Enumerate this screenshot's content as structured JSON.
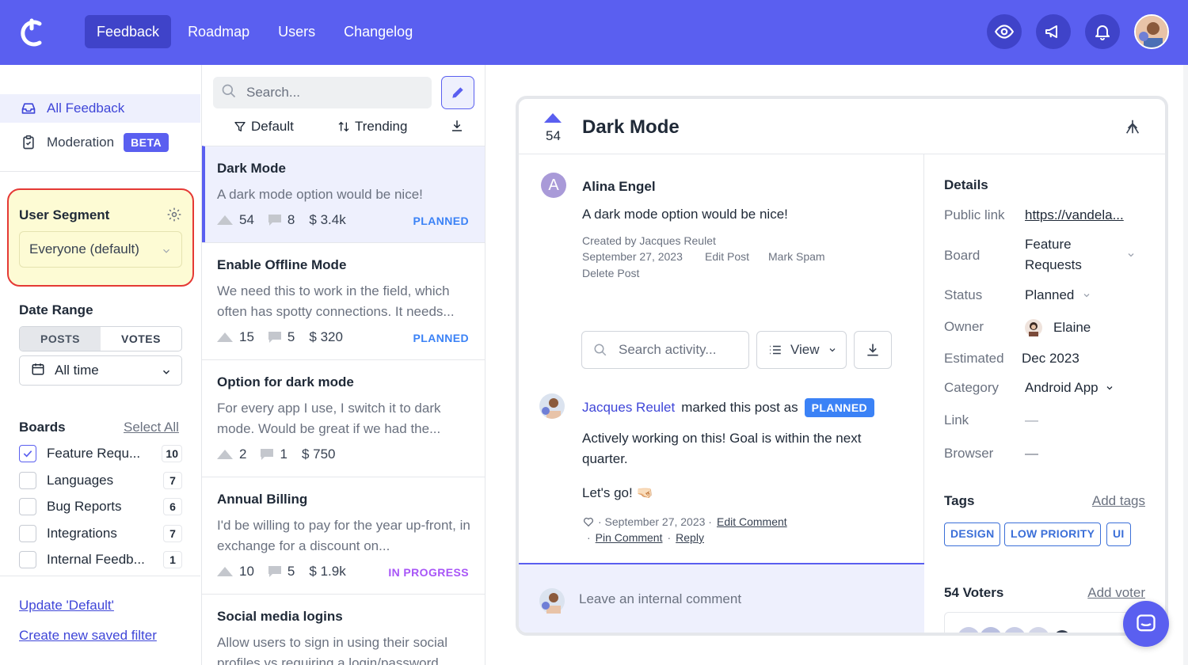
{
  "nav": {
    "items": [
      {
        "label": "Feedback"
      },
      {
        "label": "Roadmap"
      },
      {
        "label": "Users"
      },
      {
        "label": "Changelog"
      }
    ]
  },
  "sidebar": {
    "all_feedback": "All Feedback",
    "moderation": "Moderation",
    "beta": "BETA",
    "user_segment_title": "User Segment",
    "user_segment_value": "Everyone (default)",
    "date_range_title": "Date Range",
    "toggle_posts": "POSTS",
    "toggle_votes": "VOTES",
    "date_value": "All time",
    "boards_title": "Boards",
    "select_all": "Select All",
    "boards": [
      {
        "label": "Feature Requ...",
        "count": "10",
        "checked": true
      },
      {
        "label": "Languages",
        "count": "7",
        "checked": false
      },
      {
        "label": "Bug Reports",
        "count": "6",
        "checked": false
      },
      {
        "label": "Integrations",
        "count": "7",
        "checked": false
      },
      {
        "label": "Internal Feedb...",
        "count": "1",
        "checked": false
      }
    ],
    "update_default": "Update 'Default'",
    "create_filter": "Create new saved filter"
  },
  "list": {
    "search_placeholder": "Search...",
    "sort_default": "Default",
    "sort_trending": "Trending",
    "posts": [
      {
        "title": "Dark Mode",
        "desc": "A dark mode option would be nice!",
        "votes": "54",
        "comments": "8",
        "mrr": "$ 3.4k",
        "status": "PLANNED",
        "status_color": "#3b82f6"
      },
      {
        "title": "Enable Offline Mode",
        "desc": "We need this to work in the field, which often has spotty connections. It needs...",
        "votes": "15",
        "comments": "5",
        "mrr": "$ 320",
        "status": "PLANNED",
        "status_color": "#3b82f6"
      },
      {
        "title": "Option for dark mode",
        "desc": "For every app I use, I switch it to dark mode. Would be great if we had the...",
        "votes": "2",
        "comments": "1",
        "mrr": "$ 750",
        "status": "",
        "status_color": "#3b82f6"
      },
      {
        "title": "Annual Billing",
        "desc": "I'd be willing to pay for the year up-front, in exchange for a discount on...",
        "votes": "10",
        "comments": "5",
        "mrr": "$ 1.9k",
        "status": "IN PROGRESS",
        "status_color": "#a855f7"
      },
      {
        "title": "Social media logins",
        "desc": "Allow users to sign in using their social profiles vs requiring a login/password...",
        "votes": "",
        "comments": "",
        "mrr": "",
        "status": "",
        "status_color": "#3b82f6"
      }
    ]
  },
  "detail": {
    "votes": "54",
    "title": "Dark Mode",
    "author_initial": "A",
    "author": "Alina Engel",
    "body": "A dark mode option would be nice!",
    "created_by": "Created by Jacques Reulet",
    "date": "September 27, 2023",
    "edit_post": "Edit Post",
    "mark_spam": "Mark Spam",
    "delete_post": "Delete Post",
    "search_activity": "Search activity...",
    "view": "View",
    "activity_name": "Jacques Reulet",
    "activity_text": "marked this post as",
    "activity_badge": "PLANNED",
    "comment_text": "Actively working on this! Goal is within the next quarter.",
    "comment_text2": "Let's go! 🤜🏻",
    "comment_date": "· September 27, 2023 ·",
    "edit_comment": "Edit Comment",
    "pin_comment": "Pin Comment",
    "reply": "Reply",
    "internal_placeholder": "Leave an internal comment"
  },
  "details_panel": {
    "title": "Details",
    "public_link_label": "Public link",
    "public_link_value": "https://vandela...",
    "board_label": "Board",
    "board_value_1": "Feature",
    "board_value_2": "Requests",
    "status_label": "Status",
    "status_value": "Planned",
    "owner_label": "Owner",
    "owner_value": "Elaine",
    "estimated_label": "Estimated",
    "estimated_value": "Dec 2023",
    "category_label": "Category",
    "category_value": "Android App",
    "link_label": "Link",
    "link_value": "—",
    "browser_label": "Browser",
    "browser_value": "—",
    "tags_title": "Tags",
    "add_tags": "Add tags",
    "tags": [
      "DESIGN",
      "LOW PRIORITY",
      "UI"
    ],
    "voters_title": "54 Voters",
    "add_voter": "Add voter"
  }
}
